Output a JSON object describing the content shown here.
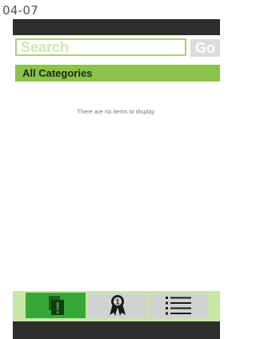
{
  "caption": "04-07",
  "search": {
    "placeholder": "Search",
    "go_label": "Go"
  },
  "category": {
    "label": "All Categories"
  },
  "list": {
    "empty_message": "There are no items to display."
  },
  "tabs": [
    {
      "name": "new-items",
      "icon": "stacked-documents-exclamation-icon",
      "active": true
    },
    {
      "name": "top-rated",
      "icon": "award-ribbon-icon",
      "badge": "1",
      "active": false
    },
    {
      "name": "list",
      "icon": "list-icon",
      "active": false
    }
  ],
  "colors": {
    "accent": "#8bc34a",
    "active_tab": "#36a836",
    "tab_bar": "#c8e6a7",
    "chrome": "#2d2d2d"
  }
}
